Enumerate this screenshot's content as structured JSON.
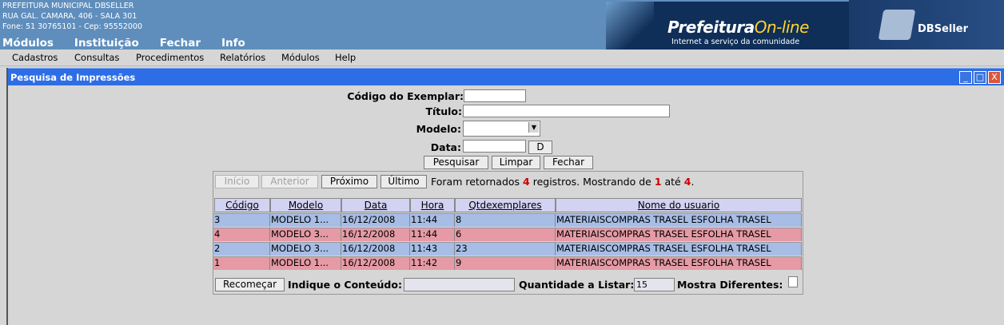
{
  "header": {
    "org_name": "PREFEITURA MUNICIPAL DBSELLER",
    "address": "RUA GAL. CAMARA, 406 - SALA 301",
    "phone": "Fone: 51 30765101  -  Cep: 95552000",
    "top_menu": [
      "Módulos",
      "Instituição",
      "Fechar",
      "Info"
    ],
    "banner_title_main": "Prefeitura",
    "banner_title_accent": "On-line",
    "banner_subtitle": "Internet a serviço da comunidade",
    "brand": "DBSeller"
  },
  "menubar": [
    "Cadastros",
    "Consultas",
    "Procedimentos",
    "Relatórios",
    "Módulos",
    "Help"
  ],
  "window": {
    "title": "Pesquisa de Impressões",
    "controls": [
      "_",
      "□",
      "X"
    ]
  },
  "form": {
    "codigo_label": "Código do Exemplar:",
    "titulo_label": "Título:",
    "modelo_label": "Modelo:",
    "data_label": "Data:",
    "data_btn": "D",
    "pesquisar": "Pesquisar",
    "limpar": "Limpar",
    "fechar": "Fechar"
  },
  "pagination": {
    "inicio": "Início",
    "anterior": "Anterior",
    "proximo": "Próximo",
    "ultimo": "Último",
    "msg_a": "Foram retornados",
    "total": "4",
    "msg_b": "registros. Mostrando de",
    "from": "1",
    "msg_c": "até",
    "to": "4",
    "msg_d": "."
  },
  "table": {
    "columns": [
      "Código",
      "Modelo",
      "Data",
      "Hora",
      "Qtdexemplares",
      "Nome do usuario"
    ],
    "rows": [
      [
        "3",
        "MODELO 1...",
        "16/12/2008",
        "11:44",
        "8",
        "MATERIAISCOMPRAS TRASEL ESFOLHA TRASEL"
      ],
      [
        "4",
        "MODELO 3...",
        "16/12/2008",
        "11:44",
        "6",
        "MATERIAISCOMPRAS TRASEL ESFOLHA TRASEL"
      ],
      [
        "2",
        "MODELO 3...",
        "16/12/2008",
        "11:43",
        "23",
        "MATERIAISCOMPRAS TRASEL ESFOLHA TRASEL"
      ],
      [
        "1",
        "MODELO 1...",
        "16/12/2008",
        "11:42",
        "9",
        "MATERIAISCOMPRAS TRASEL ESFOLHA TRASEL"
      ]
    ],
    "row_colors": [
      "#a7bde6",
      "#e59aa5",
      "#a7bde6",
      "#e59aa5"
    ]
  },
  "footer": {
    "recomecar": "Recomeçar",
    "indique_label": "Indique o Conteúdo:",
    "quantidade_label": "Quantidade a Listar:",
    "quantidade_value": "15",
    "mostra_label": "Mostra Diferentes:"
  }
}
